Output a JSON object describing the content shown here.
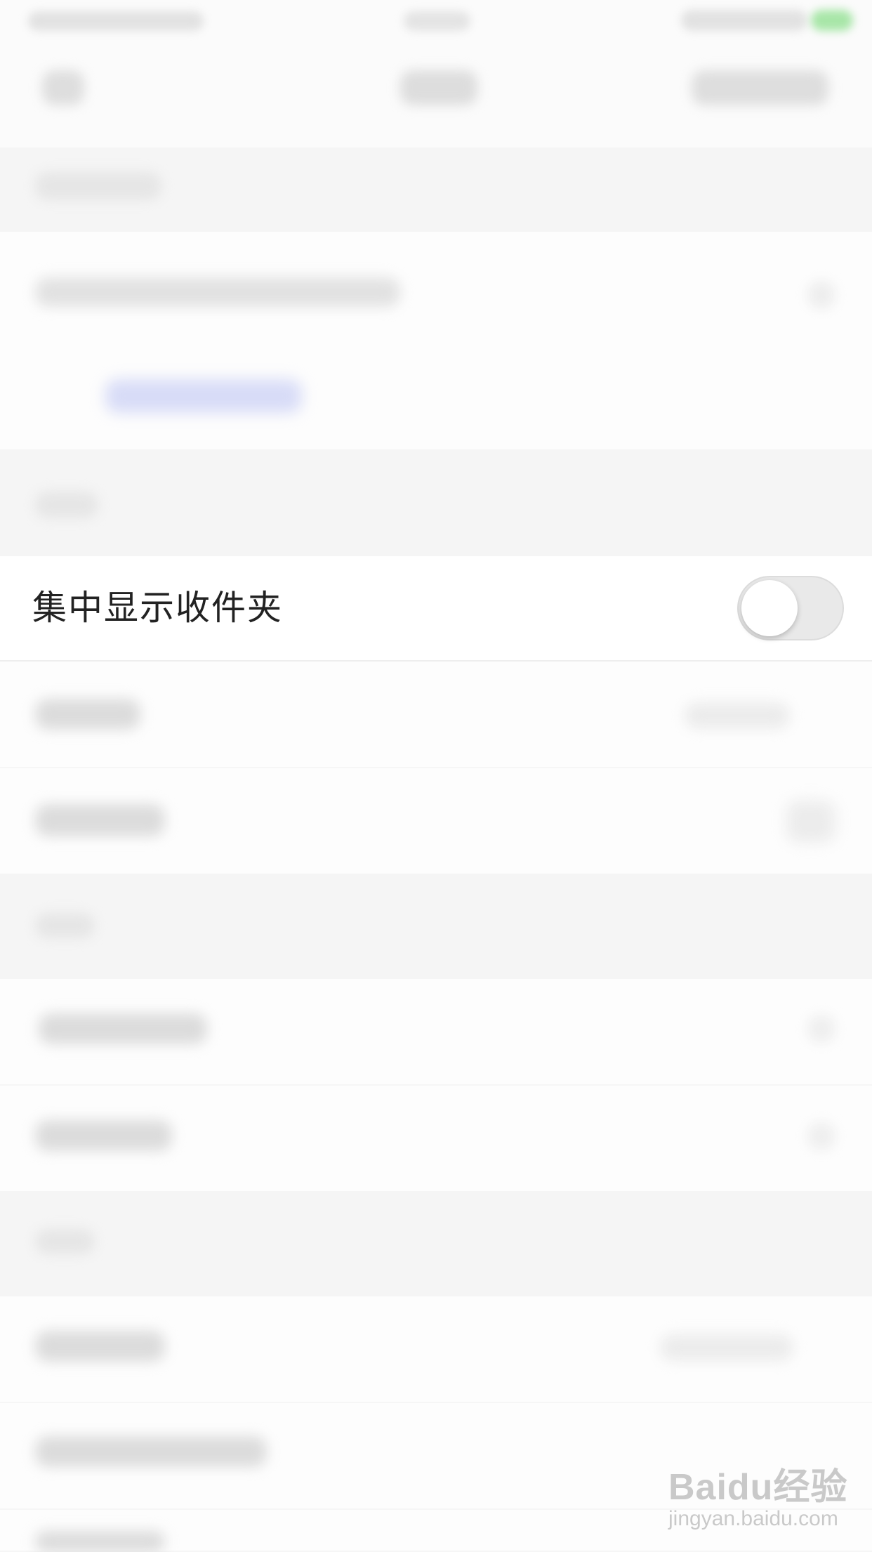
{
  "settings": {
    "toggle_row": {
      "label": "集中显示收件夹",
      "enabled": false
    }
  },
  "watermark": {
    "brand": "Baidu经验",
    "url": "jingyan.baidu.com"
  },
  "colors": {
    "accent_link": "#d8dcf7",
    "status_battery": "#a8e6a8",
    "toggle_off": "#e9e9e9"
  }
}
